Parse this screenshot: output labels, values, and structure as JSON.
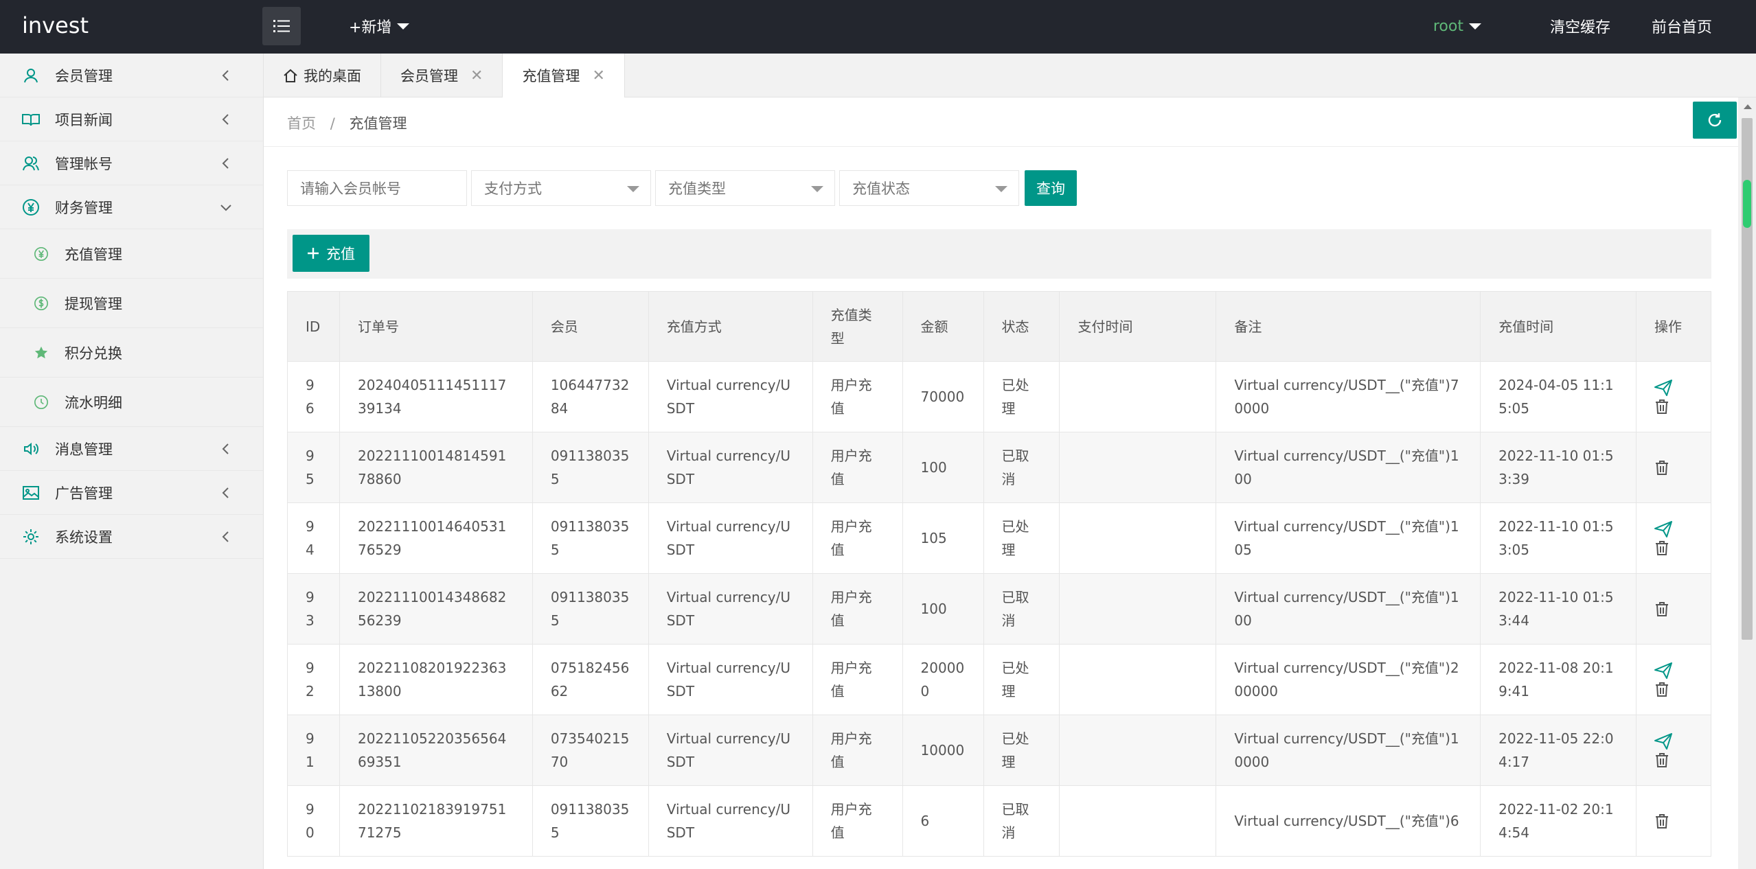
{
  "app": {
    "logo": "invest"
  },
  "topbar": {
    "add_new": "+新增",
    "user": "root",
    "clear_cache": "清空缓存",
    "front_home": "前台首页"
  },
  "sidebar": {
    "items": [
      {
        "label": "会员管理",
        "icon": "user-icon"
      },
      {
        "label": "项目新闻",
        "icon": "book-icon"
      },
      {
        "label": "管理帐号",
        "icon": "users-icon"
      },
      {
        "label": "财务管理",
        "icon": "yen-icon"
      },
      {
        "label": "消息管理",
        "icon": "speaker-icon"
      },
      {
        "label": "广告管理",
        "icon": "image-icon"
      },
      {
        "label": "系统设置",
        "icon": "gear-icon"
      }
    ],
    "sub_items": [
      {
        "label": "充值管理",
        "icon": "yen-icon"
      },
      {
        "label": "提现管理",
        "icon": "dollar-icon"
      },
      {
        "label": "积分兑换",
        "icon": "star-icon"
      },
      {
        "label": "流水明细",
        "icon": "clock-icon"
      }
    ]
  },
  "tabs": [
    {
      "label": "我的桌面",
      "icon": "home-icon"
    },
    {
      "label": "会员管理"
    },
    {
      "label": "充值管理"
    }
  ],
  "breadcrumb": {
    "home": "首页",
    "sep": "/",
    "current": "充值管理"
  },
  "filters": {
    "member_placeholder": "请输入会员帐号",
    "pay_method": "支付方式",
    "recharge_type": "充值类型",
    "recharge_status": "充值状态",
    "query": "查询"
  },
  "toolbar": {
    "recharge": "充值"
  },
  "table": {
    "headers": [
      "ID",
      "订单号",
      "会员",
      "充值方式",
      "充值类型",
      "金额",
      "状态",
      "支付时间",
      "备注",
      "充值时间",
      "操作"
    ],
    "rows": [
      {
        "id": "96",
        "order": "2024040511145111739134",
        "member": "10644773284",
        "method": "Virtual currency/USDT",
        "type": "用户充值",
        "amount": "70000",
        "status": "已处理",
        "pay_time": "",
        "note": "Virtual currency/USDT__(\"充值\")70000",
        "time": "2024-04-05 11:15:05",
        "send": true
      },
      {
        "id": "95",
        "order": "2022111001481459178860",
        "member": "0911380355",
        "method": "Virtual currency/USDT",
        "type": "用户充值",
        "amount": "100",
        "status": "已取消",
        "pay_time": "",
        "note": "Virtual currency/USDT__(\"充值\")100",
        "time": "2022-11-10 01:53:39",
        "send": false
      },
      {
        "id": "94",
        "order": "2022111001464053176529",
        "member": "0911380355",
        "method": "Virtual currency/USDT",
        "type": "用户充值",
        "amount": "105",
        "status": "已处理",
        "pay_time": "",
        "note": "Virtual currency/USDT__(\"充值\")105",
        "time": "2022-11-10 01:53:05",
        "send": true
      },
      {
        "id": "93",
        "order": "2022111001434868256239",
        "member": "0911380355",
        "method": "Virtual currency/USDT",
        "type": "用户充值",
        "amount": "100",
        "status": "已取消",
        "pay_time": "",
        "note": "Virtual currency/USDT__(\"充值\")100",
        "time": "2022-11-10 01:53:44",
        "send": false
      },
      {
        "id": "92",
        "order": "2022110820192236313800",
        "member": "07518245662",
        "method": "Virtual currency/USDT",
        "type": "用户充值",
        "amount": "200000",
        "status": "已处理",
        "pay_time": "",
        "note": "Virtual currency/USDT__(\"充值\")200000",
        "time": "2022-11-08 20:19:41",
        "send": true
      },
      {
        "id": "91",
        "order": "2022110522035656469351",
        "member": "07354021570",
        "method": "Virtual currency/USDT",
        "type": "用户充值",
        "amount": "10000",
        "status": "已处理",
        "pay_time": "",
        "note": "Virtual currency/USDT__(\"充值\")10000",
        "time": "2022-11-05 22:04:17",
        "send": true
      },
      {
        "id": "90",
        "order": "2022110218391975171275",
        "member": "0911380355",
        "method": "Virtual currency/USDT",
        "type": "用户充值",
        "amount": "6",
        "status": "已取消",
        "pay_time": "",
        "note": "Virtual currency/USDT__(\"充值\")6",
        "time": "2022-11-02 20:14:54",
        "send": false
      }
    ]
  },
  "colors": {
    "accent": "#009688",
    "topbar": "#23262e",
    "user": "#5fb878"
  }
}
